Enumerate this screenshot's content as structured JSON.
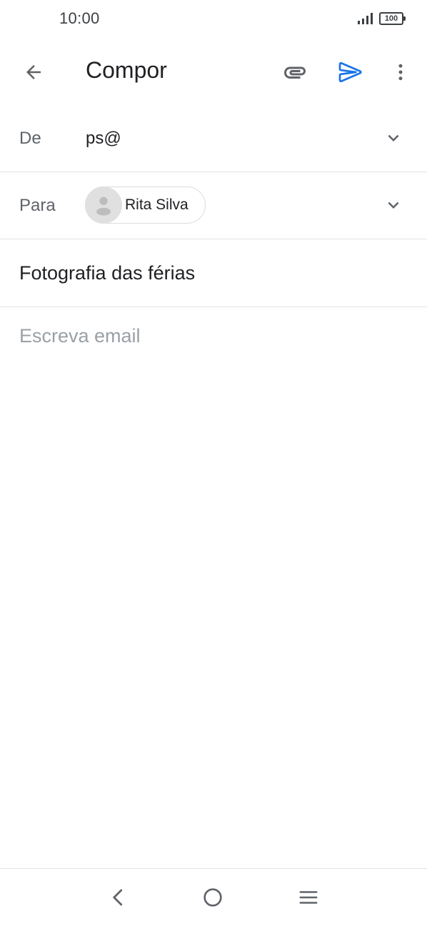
{
  "status_bar": {
    "time": "10:00",
    "battery": "100"
  },
  "app_bar": {
    "title": "Compor",
    "icons": [
      "back-arrow-icon",
      "paperclip-icon",
      "send-icon",
      "more-vert-icon"
    ],
    "send_color": "#1a73e8"
  },
  "from": {
    "label": "De",
    "value": "ps@"
  },
  "to": {
    "label": "Para",
    "recipient": "Rita Silva"
  },
  "subject": {
    "value": "Fotografia das férias"
  },
  "body": {
    "placeholder": "Escreva email"
  },
  "nav_bar": {
    "icons": [
      "nav-back-icon",
      "nav-home-icon",
      "nav-menu-icon"
    ]
  }
}
